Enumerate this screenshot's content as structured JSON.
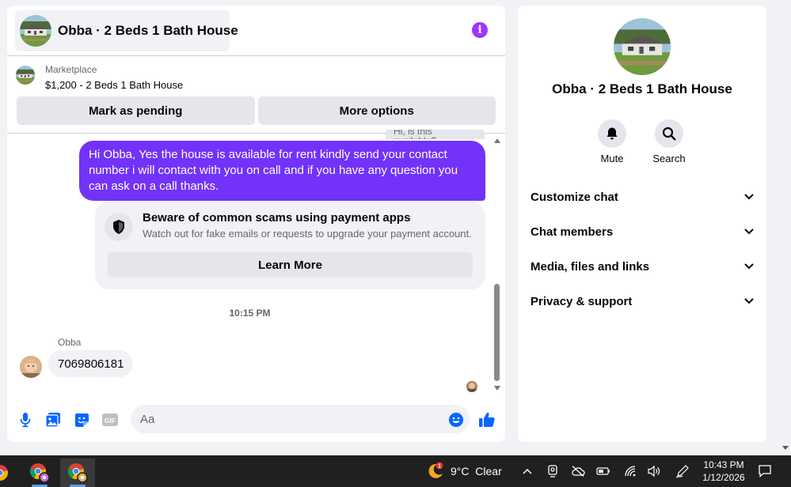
{
  "chat": {
    "title": "Obba · 2 Beds 1 Bath House",
    "marketplace_label": "Marketplace",
    "listing": "$1,200 - 2 Beds 1 Bath House",
    "mark_pending_label": "Mark as pending",
    "more_options_label": "More options",
    "cut_off_message": "Hi, is this available?",
    "sent_message": "Hi Obba, Yes the house is available for rent kindly send your contact number i will contact with you on call and if you have any question you can ask on a call thanks.",
    "warning_title": "Beware of common scams using payment apps",
    "warning_subtitle": "Watch out for fake emails or requests to upgrade your payment account.",
    "learn_more_label": "Learn More",
    "timestamp": "10:15 PM",
    "sender_name": "Obba",
    "received_message": "7069806181",
    "composer_placeholder": "Aa"
  },
  "profile": {
    "name": "Obba · 2 Beds 1 Bath House",
    "mute_label": "Mute",
    "search_label": "Search",
    "sections": [
      "Customize chat",
      "Chat members",
      "Media, files and links",
      "Privacy & support"
    ]
  },
  "taskbar": {
    "weather_temp": "9°C",
    "weather_desc": "Clear",
    "weather_badge": "1",
    "time": "10:43 PM",
    "date": "1/12/2026"
  },
  "colors": {
    "accent": "#7232fa",
    "messenger_blue": "#0866ff",
    "info_purple": "#a033ff"
  }
}
